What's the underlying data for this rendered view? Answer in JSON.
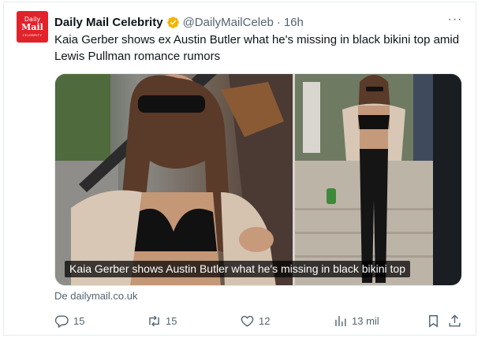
{
  "tweet": {
    "author_name": "Daily Mail Celebrity",
    "handle": "@DailyMailCeleb",
    "separator": "·",
    "time": "16h",
    "text": "Kaia Gerber shows ex Austin Butler what he's missing in black bikini top amid Lewis Pullman romance rumors",
    "avatar": {
      "line1": "Daily",
      "line2": "Mail",
      "line3": "CELEBRITY"
    },
    "verified_badge_color": "#f4b400",
    "more_label": "···"
  },
  "card": {
    "caption": "Kaia Gerber shows Austin Butler what he's missing in black bikini top",
    "source": "De dailymail.co.uk"
  },
  "actions": {
    "replies": "15",
    "reposts": "15",
    "likes": "12",
    "views": "13 mil"
  },
  "icons": [
    "reply-icon",
    "repost-icon",
    "like-icon",
    "views-icon",
    "bookmark-icon",
    "share-icon",
    "verified-badge-icon",
    "more-icon"
  ],
  "colors": {
    "brand": "#e1222a",
    "muted": "#536471",
    "text": "#0f1419"
  }
}
